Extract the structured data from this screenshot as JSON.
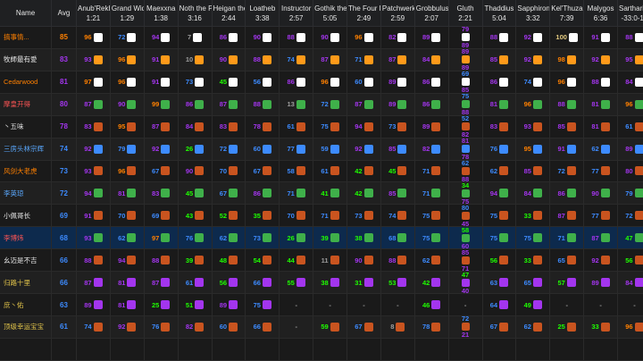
{
  "header": {
    "name_label": "Name",
    "avg_label": "Avg",
    "bosses": [
      {
        "name": "Anub'Rekhan",
        "time": "1:21"
      },
      {
        "name": "Grand Widow",
        "time": "1:29"
      },
      {
        "name": "Maexxna",
        "time": "1:38"
      },
      {
        "name": "Noth the Plaguebringer",
        "time": "3:16"
      },
      {
        "name": "Heigan the Unclean",
        "time": "2:44"
      },
      {
        "name": "Loatheb",
        "time": "3:38"
      },
      {
        "name": "Instructor",
        "time": "2:57"
      },
      {
        "name": "Gothik the Harvester",
        "time": "5:05"
      },
      {
        "name": "The Four Horsemen",
        "time": "2:49"
      },
      {
        "name": "Patchwerk",
        "time": "2:59"
      },
      {
        "name": "Grobbulus",
        "time": "2:07"
      },
      {
        "name": "Gluth",
        "time": "2:21"
      },
      {
        "name": "Thaddius",
        "time": "5:04"
      },
      {
        "name": "Sapphiron",
        "time": "3:32"
      },
      {
        "name": "Kel'Thuzad",
        "time": "7:39"
      },
      {
        "name": "Malygos",
        "time": "6:36"
      },
      {
        "name": "Sartharion",
        "time": "-33:0-10"
      }
    ]
  },
  "rows": [
    {
      "name": "搞事情...",
      "name_color": "orange",
      "avg": "85",
      "avg_q": "leg",
      "icon": "#ffffff",
      "cells": [
        [
          "96",
          "leg"
        ],
        [
          "72",
          "rare"
        ],
        [
          "94",
          "epic"
        ],
        [
          "7",
          "com"
        ],
        [
          "86",
          "epic"
        ],
        [
          "90",
          "epic"
        ],
        [
          "88",
          "epic"
        ],
        [
          "90",
          "epic"
        ],
        [
          "96",
          "leg"
        ],
        [
          "82",
          "epic"
        ],
        [
          "89",
          "epic"
        ],
        [
          "79|89",
          "epic"
        ],
        [
          "88",
          "epic"
        ],
        [
          "92",
          "epic"
        ],
        [
          "100",
          "gold"
        ],
        [
          "91",
          "epic"
        ],
        [
          "88",
          "epic"
        ]
      ]
    },
    {
      "name": "牧師最有愛",
      "name_color": "white",
      "avg": "83",
      "avg_q": "epic",
      "icon": "#ff9a1a",
      "cells": [
        [
          "93",
          "epic"
        ],
        [
          "96",
          "leg"
        ],
        [
          "91",
          "epic"
        ],
        [
          "10",
          "com"
        ],
        [
          "90",
          "epic"
        ],
        [
          "88",
          "epic"
        ],
        [
          "74",
          "rare"
        ],
        [
          "87",
          "epic"
        ],
        [
          "71",
          "rare"
        ],
        [
          "87",
          "epic"
        ],
        [
          "84",
          "epic"
        ],
        [
          "89|89",
          "epic"
        ],
        [
          "85",
          "epic"
        ],
        [
          "92",
          "epic"
        ],
        [
          "98",
          "leg"
        ],
        [
          "92",
          "epic"
        ],
        [
          "95",
          "epic"
        ]
      ]
    },
    {
      "name": "Cedarwood",
      "name_color": "orange",
      "avg": "81",
      "avg_q": "epic",
      "icon": "#ffffff",
      "cells": [
        [
          "97",
          "leg"
        ],
        [
          "96",
          "leg"
        ],
        [
          "91",
          "epic"
        ],
        [
          "73",
          "rare"
        ],
        [
          "45",
          "unc"
        ],
        [
          "56",
          "rare"
        ],
        [
          "86",
          "epic"
        ],
        [
          "96",
          "leg"
        ],
        [
          "60",
          "rare"
        ],
        [
          "89",
          "epic"
        ],
        [
          "86",
          "epic"
        ],
        [
          "69|85",
          "rare"
        ],
        [
          "86",
          "epic"
        ],
        [
          "74",
          "rare"
        ],
        [
          "96",
          "leg"
        ],
        [
          "88",
          "epic"
        ],
        [
          "84",
          "epic"
        ]
      ]
    },
    {
      "name": "摩皇开得",
      "name_color": "red",
      "avg": "80",
      "avg_q": "epic",
      "icon": "#3fb04a",
      "cells": [
        [
          "87",
          "epic"
        ],
        [
          "90",
          "epic"
        ],
        [
          "99",
          "leg"
        ],
        [
          "86",
          "epic"
        ],
        [
          "87",
          "epic"
        ],
        [
          "88",
          "epic"
        ],
        [
          "13",
          "com"
        ],
        [
          "72",
          "rare"
        ],
        [
          "87",
          "epic"
        ],
        [
          "89",
          "epic"
        ],
        [
          "86",
          "epic"
        ],
        [
          "75|88",
          "rare"
        ],
        [
          "81",
          "epic"
        ],
        [
          "96",
          "leg"
        ],
        [
          "88",
          "epic"
        ],
        [
          "81",
          "epic"
        ],
        [
          "96",
          "leg"
        ]
      ]
    },
    {
      "name": "丶五味",
      "name_color": "white",
      "avg": "78",
      "avg_q": "epic",
      "icon": "#c9541f",
      "cells": [
        [
          "83",
          "epic"
        ],
        [
          "95",
          "leg"
        ],
        [
          "87",
          "epic"
        ],
        [
          "84",
          "epic"
        ],
        [
          "83",
          "epic"
        ],
        [
          "78",
          "epic"
        ],
        [
          "61",
          "rare"
        ],
        [
          "75",
          "rare"
        ],
        [
          "94",
          "epic"
        ],
        [
          "73",
          "rare"
        ],
        [
          "89",
          "epic"
        ],
        [
          "52|82",
          "rare"
        ],
        [
          "83",
          "epic"
        ],
        [
          "93",
          "epic"
        ],
        [
          "85",
          "epic"
        ],
        [
          "81",
          "epic"
        ],
        [
          "61",
          "rare"
        ]
      ]
    },
    {
      "name": "三房头林宗辉",
      "name_color": "blue",
      "avg": "74",
      "avg_q": "rare",
      "icon": "#3d8bff",
      "cells": [
        [
          "92",
          "epic"
        ],
        [
          "79",
          "rare"
        ],
        [
          "92",
          "epic"
        ],
        [
          "26",
          "unc"
        ],
        [
          "72",
          "rare"
        ],
        [
          "60",
          "rare"
        ],
        [
          "77",
          "rare"
        ],
        [
          "59",
          "rare"
        ],
        [
          "92",
          "epic"
        ],
        [
          "85",
          "epic"
        ],
        [
          "82",
          "epic"
        ],
        [
          "81|78",
          "epic"
        ],
        [
          "76",
          "rare"
        ],
        [
          "95",
          "leg"
        ],
        [
          "91",
          "epic"
        ],
        [
          "62",
          "rare"
        ],
        [
          "89",
          "epic"
        ]
      ]
    },
    {
      "name": "风剑大老虎",
      "name_color": "orange",
      "avg": "73",
      "avg_q": "rare",
      "icon": "#c9541f",
      "cells": [
        [
          "93",
          "epic"
        ],
        [
          "96",
          "leg"
        ],
        [
          "67",
          "rare"
        ],
        [
          "90",
          "epic"
        ],
        [
          "70",
          "rare"
        ],
        [
          "67",
          "rare"
        ],
        [
          "58",
          "rare"
        ],
        [
          "61",
          "rare"
        ],
        [
          "42",
          "unc"
        ],
        [
          "45",
          "unc"
        ],
        [
          "71",
          "rare"
        ],
        [
          "62|88",
          "rare"
        ],
        [
          "62",
          "rare"
        ],
        [
          "85",
          "epic"
        ],
        [
          "72",
          "rare"
        ],
        [
          "77",
          "rare"
        ],
        [
          "80",
          "epic"
        ]
      ]
    },
    {
      "name": "李英琼",
      "name_color": "blue",
      "avg": "72",
      "avg_q": "rare",
      "icon": "#3fb04a",
      "cells": [
        [
          "94",
          "epic"
        ],
        [
          "81",
          "epic"
        ],
        [
          "83",
          "epic"
        ],
        [
          "45",
          "unc"
        ],
        [
          "67",
          "rare"
        ],
        [
          "86",
          "epic"
        ],
        [
          "71",
          "rare"
        ],
        [
          "41",
          "unc"
        ],
        [
          "42",
          "unc"
        ],
        [
          "85",
          "epic"
        ],
        [
          "71",
          "rare"
        ],
        [
          "34|75",
          "unc"
        ],
        [
          "94",
          "epic"
        ],
        [
          "84",
          "epic"
        ],
        [
          "86",
          "epic"
        ],
        [
          "90",
          "epic"
        ],
        [
          "79",
          "rare"
        ]
      ]
    },
    {
      "name": "小佩哥长",
      "name_color": "white",
      "avg": "69",
      "avg_q": "rare",
      "icon": "#c9541f",
      "cells": [
        [
          "91",
          "epic"
        ],
        [
          "70",
          "rare"
        ],
        [
          "69",
          "rare"
        ],
        [
          "43",
          "unc"
        ],
        [
          "52",
          "unc"
        ],
        [
          "35",
          "unc"
        ],
        [
          "70",
          "rare"
        ],
        [
          "71",
          "rare"
        ],
        [
          "73",
          "rare"
        ],
        [
          "74",
          "rare"
        ],
        [
          "75",
          "rare"
        ],
        [
          "80|45",
          "rare"
        ],
        [
          "75",
          "rare"
        ],
        [
          "33",
          "unc"
        ],
        [
          "87",
          "epic"
        ],
        [
          "77",
          "rare"
        ],
        [
          "72",
          "rare"
        ]
      ]
    },
    {
      "name": "李博炜",
      "name_color": "red",
      "avg": "68",
      "avg_q": "rare",
      "icon": "#3fb04a",
      "highlight": true,
      "cells": [
        [
          "93",
          "epic"
        ],
        [
          "62",
          "rare"
        ],
        [
          "97",
          "leg"
        ],
        [
          "76",
          "rare"
        ],
        [
          "62",
          "rare"
        ],
        [
          "73",
          "rare"
        ],
        [
          "26",
          "unc"
        ],
        [
          "39",
          "unc"
        ],
        [
          "38",
          "unc"
        ],
        [
          "68",
          "rare"
        ],
        [
          "75",
          "rare"
        ],
        [
          "58|60",
          "unc"
        ],
        [
          "75",
          "rare"
        ],
        [
          "75",
          "rare"
        ],
        [
          "71",
          "rare"
        ],
        [
          "87",
          "epic"
        ],
        [
          "47",
          "unc"
        ]
      ]
    },
    {
      "name": "幺迈是不吉",
      "name_color": "white",
      "avg": "66",
      "avg_q": "rare",
      "icon": "#c9541f",
      "cells": [
        [
          "88",
          "epic"
        ],
        [
          "94",
          "epic"
        ],
        [
          "88",
          "epic"
        ],
        [
          "39",
          "unc"
        ],
        [
          "48",
          "unc"
        ],
        [
          "54",
          "unc"
        ],
        [
          "44",
          "unc"
        ],
        [
          "11",
          "com"
        ],
        [
          "90",
          "epic"
        ],
        [
          "88",
          "epic"
        ],
        [
          "62",
          "rare"
        ],
        [
          "85|71",
          "epic"
        ],
        [
          "56",
          "unc"
        ],
        [
          "33",
          "unc"
        ],
        [
          "65",
          "rare"
        ],
        [
          "92",
          "epic"
        ],
        [
          "56",
          "unc"
        ]
      ]
    },
    {
      "name": "归路十里",
      "name_color": "gold",
      "avg": "66",
      "avg_q": "rare",
      "icon": "#a335ee",
      "cells": [
        [
          "87",
          "epic"
        ],
        [
          "81",
          "epic"
        ],
        [
          "87",
          "epic"
        ],
        [
          "61",
          "rare"
        ],
        [
          "56",
          "unc"
        ],
        [
          "66",
          "rare"
        ],
        [
          "55",
          "unc"
        ],
        [
          "38",
          "unc"
        ],
        [
          "31",
          "unc"
        ],
        [
          "53",
          "unc"
        ],
        [
          "42",
          "unc"
        ],
        [
          "47|40",
          "unc"
        ],
        [
          "63",
          "rare"
        ],
        [
          "65",
          "rare"
        ],
        [
          "57",
          "unc"
        ],
        [
          "89",
          "epic"
        ],
        [
          "84",
          "epic"
        ]
      ]
    },
    {
      "name": "庶丶佑",
      "name_color": "gold",
      "avg": "63",
      "avg_q": "rare",
      "icon": "#a335ee",
      "cells": [
        [
          "89",
          "epic"
        ],
        [
          "81",
          "epic"
        ],
        [
          "25",
          "unc"
        ],
        [
          "51",
          "unc"
        ],
        [
          "89",
          "epic"
        ],
        [
          "75",
          "rare"
        ],
        [
          "-",
          "com"
        ],
        [
          "-",
          "com"
        ],
        [
          "-",
          "com"
        ],
        [
          "-",
          "com"
        ],
        [
          "46",
          "unc"
        ],
        [
          "-",
          "com"
        ],
        [
          "64",
          "rare"
        ],
        [
          "49",
          "unc"
        ],
        [
          "-",
          "com"
        ],
        [
          "-",
          "com"
        ],
        [
          "-",
          "com"
        ]
      ]
    },
    {
      "name": "顶级幸运宝宝",
      "name_color": "gold",
      "avg": "61",
      "avg_q": "rare",
      "icon": "#c9541f",
      "cells": [
        [
          "74",
          "rare"
        ],
        [
          "92",
          "epic"
        ],
        [
          "76",
          "rare"
        ],
        [
          "82",
          "epic"
        ],
        [
          "60",
          "rare"
        ],
        [
          "66",
          "rare"
        ],
        [
          "-",
          "com"
        ],
        [
          "59",
          "unc"
        ],
        [
          "67",
          "rare"
        ],
        [
          "8",
          "com"
        ],
        [
          "78",
          "rare"
        ],
        [
          "72|21",
          "rare"
        ],
        [
          "67",
          "rare"
        ],
        [
          "62",
          "rare"
        ],
        [
          "25",
          "unc"
        ],
        [
          "33",
          "unc"
        ],
        [
          "96",
          "leg"
        ]
      ]
    },
    {
      "name": "",
      "name_color": "white",
      "avg": "",
      "avg_q": "com",
      "icon": "#888888",
      "cells": [
        [
          "",
          "com"
        ],
        [
          "",
          "com"
        ],
        [
          "",
          "com"
        ],
        [
          "",
          "com"
        ],
        [
          "",
          "com"
        ],
        [
          "",
          "com"
        ],
        [
          "",
          "com"
        ],
        [
          "",
          "com"
        ],
        [
          "",
          "com"
        ],
        [
          "",
          "com"
        ],
        [
          "",
          "com"
        ],
        [
          "",
          "com"
        ],
        [
          "",
          "com"
        ],
        [
          "",
          "com"
        ],
        [
          "",
          "com"
        ],
        [
          "",
          "com"
        ],
        [
          "",
          "com"
        ]
      ]
    }
  ]
}
